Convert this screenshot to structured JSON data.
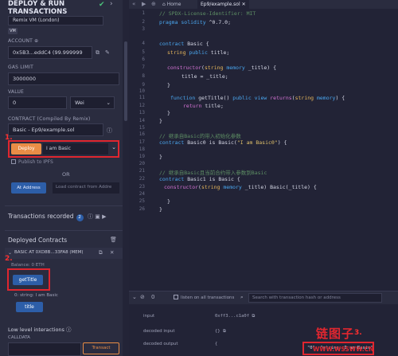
{
  "panel": {
    "title_line1": "DEPLOY & RUN",
    "title_line2": "TRANSACTIONS",
    "environment_value": "Remix VM (London)",
    "vm_badge": "VM",
    "account_label": "ACCOUNT",
    "account_value": "0x5B3...eddC4 (99.999999",
    "gas_limit_label": "GAS LIMIT",
    "gas_limit_value": "3000000",
    "value_label": "VALUE",
    "value_amount": "0",
    "value_unit": "Wei",
    "contract_label": "CONTRACT (Compiled By Remix)",
    "contract_value": "Basic - Ep9/example.sol",
    "deploy_button": "Deploy",
    "deploy_arg": "I am Basic",
    "mark_1": "1.",
    "publish_label": "Publish to IPFS",
    "or_label": "OR",
    "at_address_button": "At Address",
    "load_contract_placeholder": "Load contract from Addre",
    "tx_recorded_label": "Transactions recorded",
    "tx_recorded_count": "2",
    "deployed_label": "Deployed Contracts",
    "instance_name": "BASIC AT 0XD8B...33FA8 (MEM(",
    "balance": "Balance: 0 ETH",
    "mark_2": "2.",
    "gettitle_button": "getTitle",
    "return_value": "0: string: I am Basic",
    "title_button": "title",
    "low_level_label": "Low level interactions",
    "calldata_label": "CALLDATA",
    "transact_button": "Transact"
  },
  "editor": {
    "tab_home": "Home",
    "tab_file": "Ep9/example.sol",
    "line_numbers": [
      "1",
      "2",
      "3",
      "4",
      "5",
      "6",
      "7",
      "8",
      "9",
      "10",
      "11",
      "12",
      "13",
      "14",
      "15",
      "16",
      "17",
      "18",
      "19",
      "20",
      "21",
      "22",
      "23",
      "24",
      "25",
      "26"
    ],
    "code": {
      "l1": "// SPDX-License-Identifier: MIT",
      "l2_kw": "pragma solidity",
      "l2_rest": " ^0.7.0;",
      "l4_kw": "contract",
      "l4_rest": " Basic {",
      "l5_ty": "string",
      "l5_kw": " public",
      "l5_rest": " title;",
      "l7_fn": "constructor",
      "l7_a": "(",
      "l7_ty": "string",
      "l7_kw": " memory",
      "l7_rest": " _title) {",
      "l8": "title = _title;",
      "l9": "}",
      "l11_kw1": "function",
      "l11_a": " getTitle() ",
      "l11_kw2": "public view",
      "l11_b": " ",
      "l11_fn": "returns",
      "l11_c": "(",
      "l11_ty": "string",
      "l11_kw3": " memory",
      "l11_d": ") {",
      "l12_fn": "return",
      "l12_rest": " title;",
      "l13": "}",
      "l14": "}",
      "l16": "// 继承自Basic的带入初始化参数",
      "l17_kw": "contract",
      "l17_a": " Basic0 is Basic(",
      "l17_st": "\"I am Basic0\"",
      "l17_b": ") {",
      "l19": "}",
      "l21": "// 继承自Basic且当前合约带入参数到Basic",
      "l22_kw": "contract",
      "l22_rest": " Basic1 is Basic {",
      "l23_fn": "constructor",
      "l23_a": "(",
      "l23_ty": "string",
      "l23_kw": " memory",
      "l23_rest": " _title) Basic(_title) {",
      "l25": "}",
      "l26": "}"
    }
  },
  "terminal": {
    "count": "0",
    "listen_label": "listen on all transactions",
    "search_placeholder": "Search with transaction hash or address",
    "input_label": "input",
    "input_value": "0xff3...c1a0f",
    "decoded_input_label": "decoded input",
    "decoded_input_value": "{}",
    "decoded_output_label": "decoded output",
    "decoded_output_brace": "{",
    "decoded_output_value": "\"0\": \"string: I am Basic\"",
    "mark_3": "3."
  },
  "watermark": {
    "title": "链图子",
    "url": "WWW.WSSWW.CN"
  }
}
